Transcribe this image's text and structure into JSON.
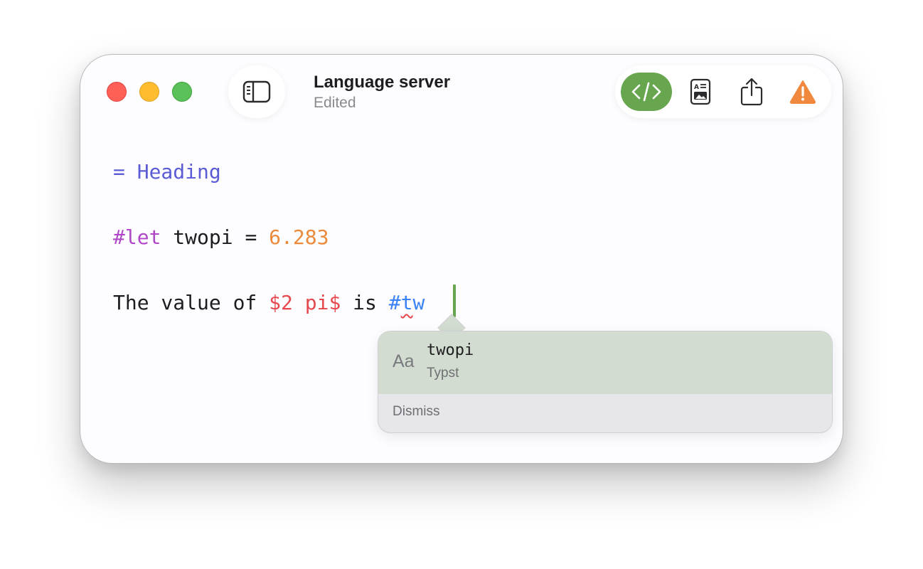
{
  "window": {
    "title": "Language server",
    "subtitle": "Edited"
  },
  "toolbar": {
    "items": [
      {
        "icon": "code-icon",
        "active": true
      },
      {
        "icon": "preview-document-icon",
        "active": false
      },
      {
        "icon": "share-icon",
        "active": false
      },
      {
        "icon": "warning-icon",
        "active": false
      }
    ],
    "accent": "#67a64e",
    "warning_color": "#f0883e"
  },
  "editor": {
    "line1": {
      "marker": "= ",
      "text": "Heading"
    },
    "line2": {
      "keyword": "#let",
      "name": " twopi = ",
      "value": "6.283"
    },
    "line3": {
      "prefix": "The value of ",
      "math": "$2 pi$",
      "middle": " is ",
      "typed": "#tw"
    }
  },
  "autocomplete": {
    "kind_label": "Aa",
    "suggestion": "twopi",
    "source": "Typst",
    "dismiss_label": "Dismiss"
  }
}
